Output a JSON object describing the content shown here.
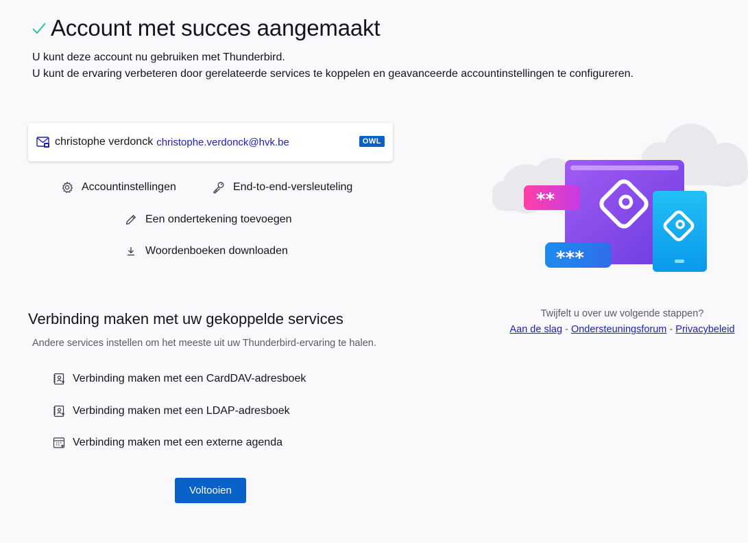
{
  "header": {
    "title": "Account met succes aangemaakt",
    "intro_line1": "U kunt deze account nu gebruiken met Thunderbird.",
    "intro_line2": "U kunt de ervaring verbeteren door gerelateerde services te koppelen en geavanceerde accountinstellingen te configureren."
  },
  "account": {
    "name": "christophe verdonck",
    "email": "christophe.verdonck@hvk.be",
    "badge": "OWL"
  },
  "actions": {
    "account_settings": "Accountinstellingen",
    "e2e": "End-to-end-versleuteling",
    "signature": "Een ondertekening toevoegen",
    "dictionaries": "Woordenboeken downloaden"
  },
  "services": {
    "title": "Verbinding maken met uw gekoppelde services",
    "subtitle": "Andere services instellen om het meeste uit uw Thunderbird-ervaring te halen.",
    "carddav": "Verbinding maken met een CardDAV-adresboek",
    "ldap": "Verbinding maken met een LDAP-adresboek",
    "calendar": "Verbinding maken met een externe agenda"
  },
  "finish_label": "Voltooien",
  "help": {
    "question": "Twijfelt u over uw volgende stappen?",
    "link_start": "Aan de slag",
    "link_forum": "Ondersteuningsforum",
    "link_privacy": "Privacybeleid",
    "separator": "-"
  },
  "illustration": {
    "pw_short": "**",
    "pw_long": "***"
  },
  "colors": {
    "accent": "#0a61c8",
    "success": "#2ac3a2",
    "link": "#1d1fb8"
  }
}
